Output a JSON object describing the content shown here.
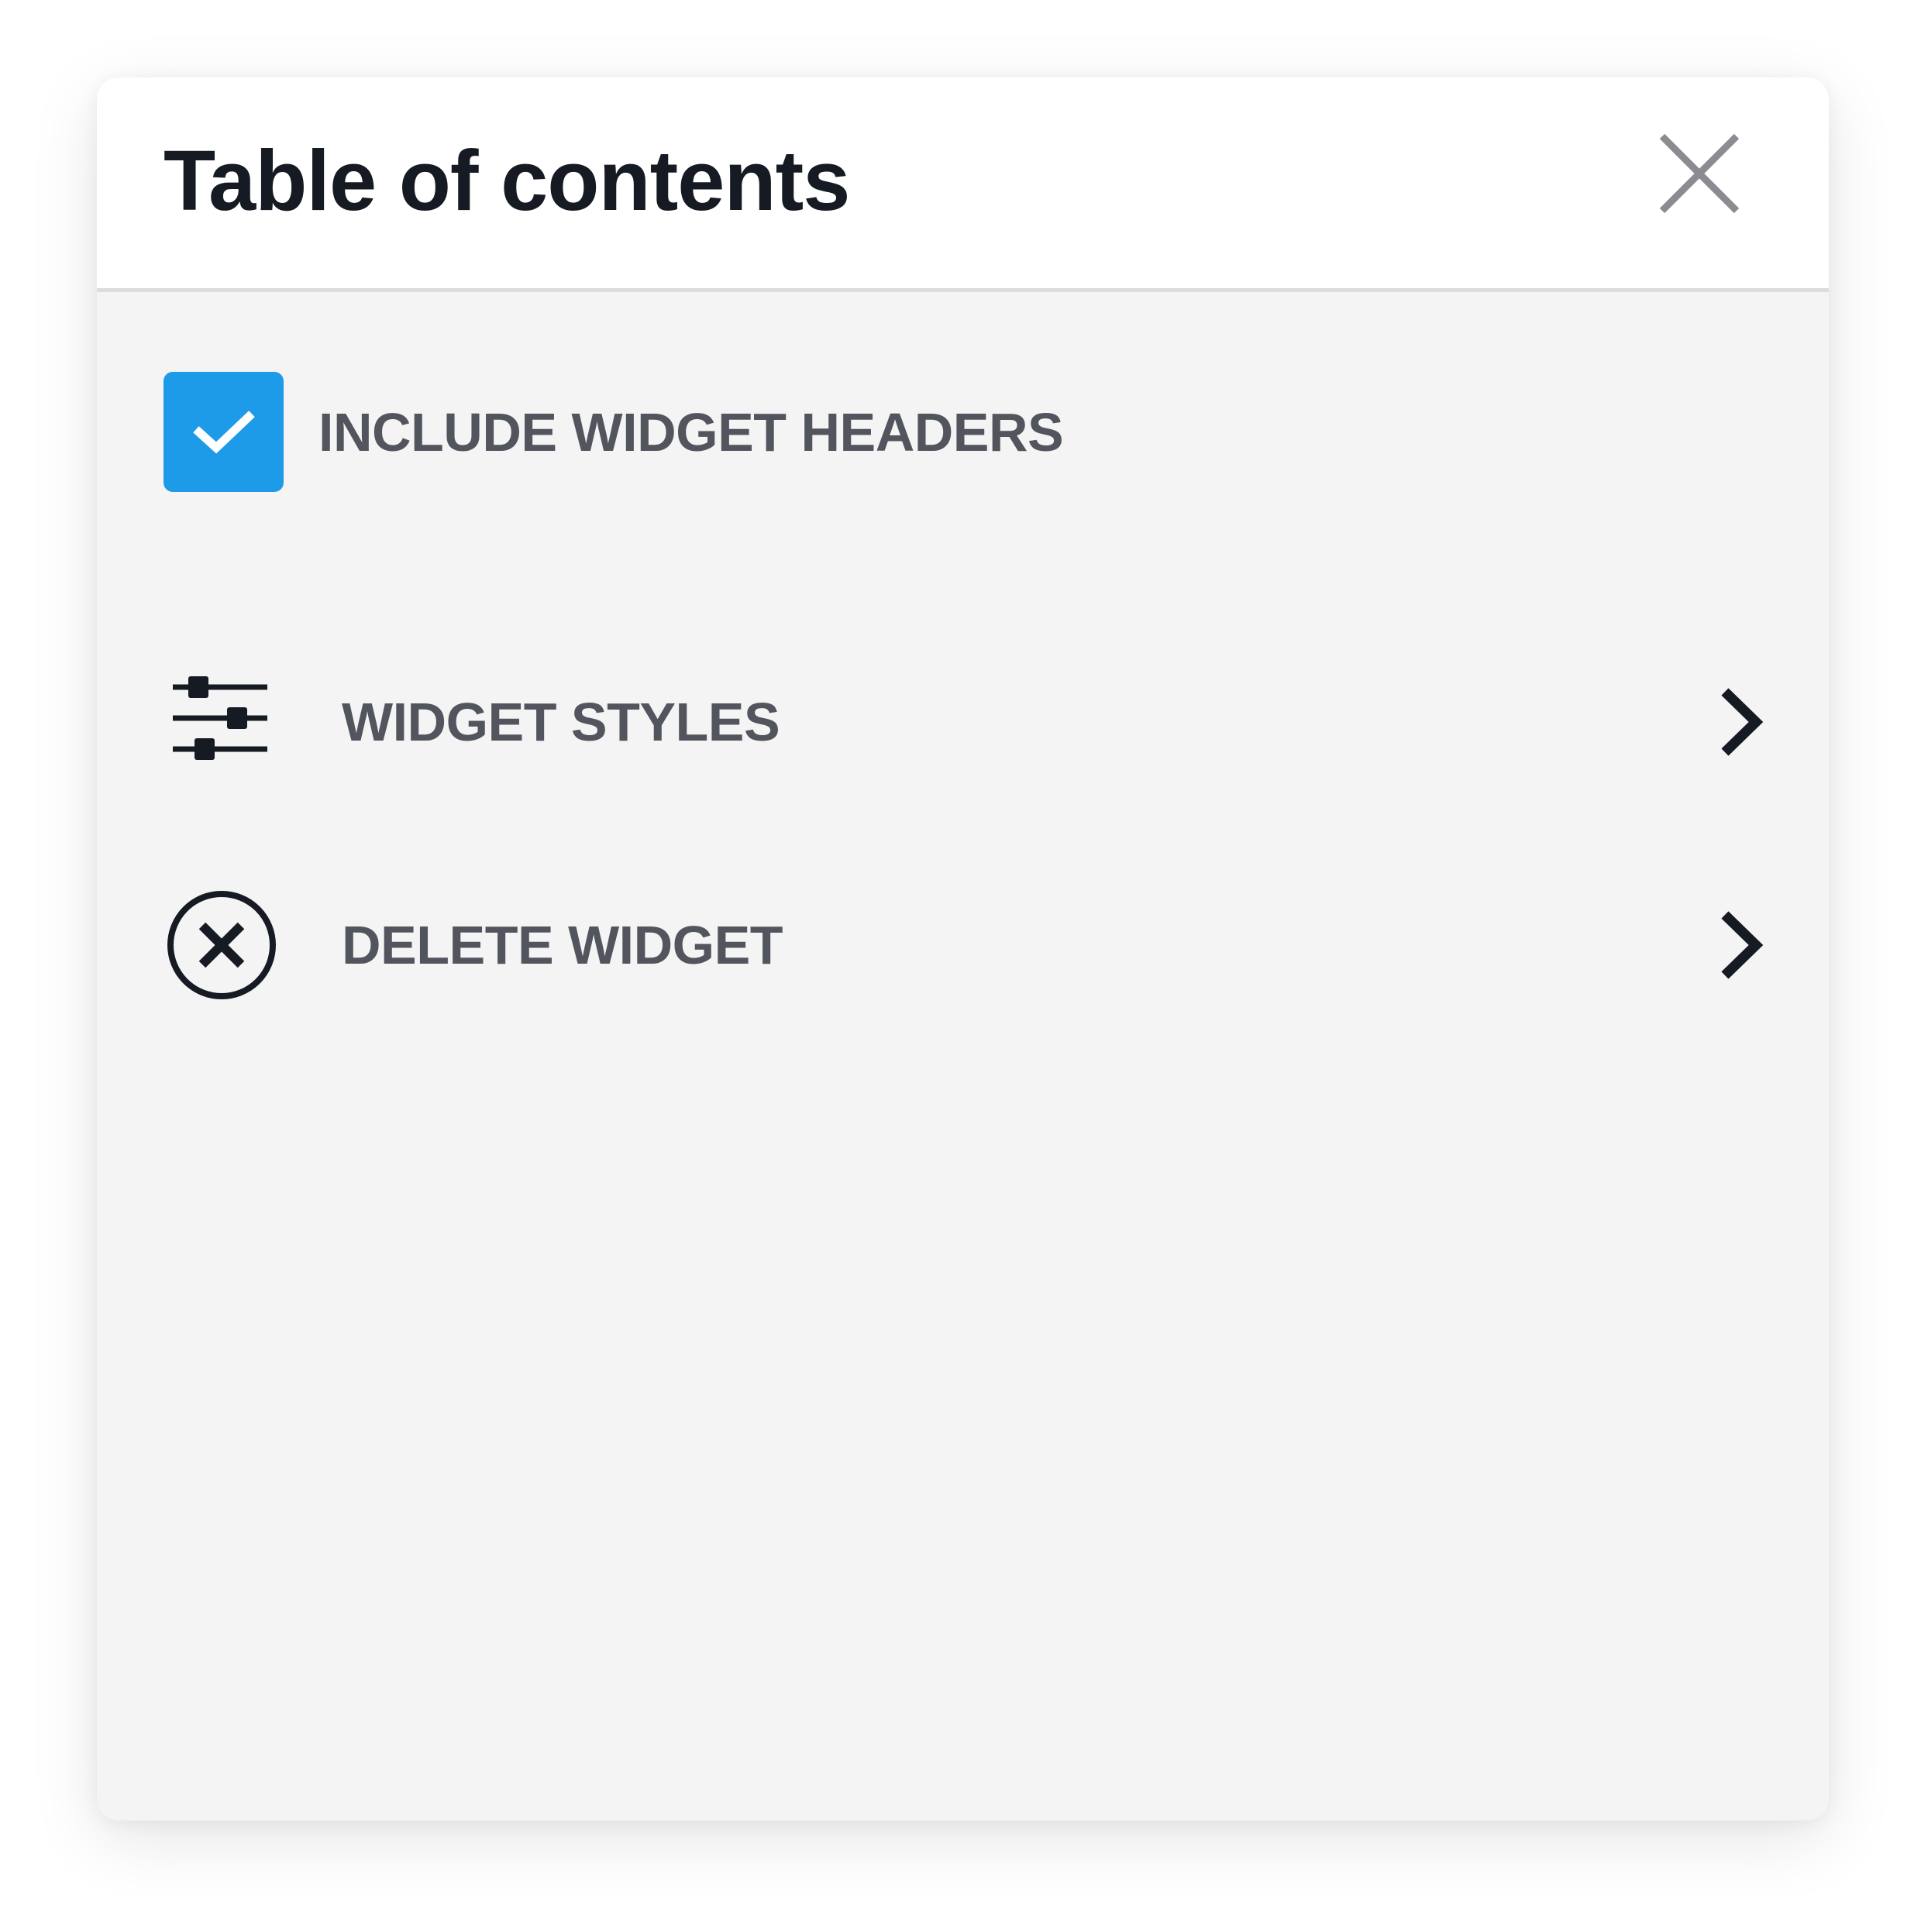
{
  "panel": {
    "title": "Table of contents",
    "close_icon": "close-icon"
  },
  "options": {
    "include_headers": {
      "label": "INCLUDE WIDGET HEADERS",
      "checked": true,
      "check_color": "#1e9be8"
    }
  },
  "menu": {
    "items": [
      {
        "label": "WIDGET STYLES",
        "icon": "sliders-icon",
        "trailing_icon": "chevron-right-icon"
      },
      {
        "label": "DELETE WIDGET",
        "icon": "circle-x-icon",
        "trailing_icon": "chevron-right-icon"
      }
    ]
  },
  "colors": {
    "title_text": "#161a23",
    "label_text": "#52555d",
    "panel_bg": "#f4f4f4",
    "header_bg": "#ffffff",
    "accent": "#1e9be8",
    "close_icon": "#8a8c91"
  }
}
